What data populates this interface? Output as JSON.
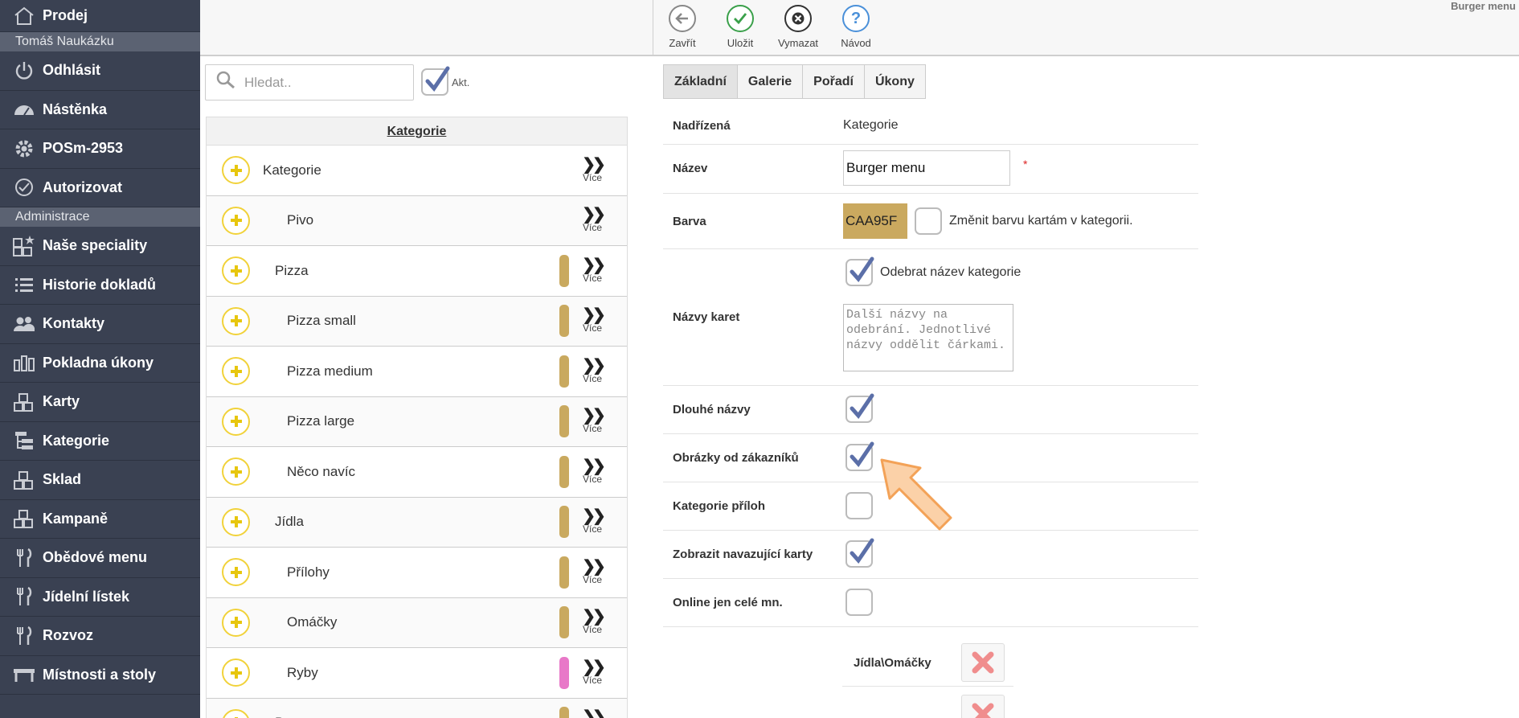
{
  "sidebar": {
    "top_item": "Prodej",
    "user_name": "Tomáš Naukázku",
    "items_a": [
      "Odhlásit",
      "Nástěnka",
      "POSm-2953",
      "Autorizovat"
    ],
    "section_admin": "Administrace",
    "items_b": [
      "Naše speciality",
      "Historie dokladů",
      "Kontakty",
      "Pokladna úkony",
      "Karty",
      "Kategorie",
      "Sklad",
      "Kampaně",
      "Obědové menu",
      "Jídelní lístek",
      "Rozvoz",
      "Místnosti a stoly"
    ]
  },
  "toolbar": {
    "close_label": "Zavřít",
    "save_label": "Uložit",
    "delete_label": "Vymazat",
    "help_label": "Návod",
    "doc_title": "Burger menu"
  },
  "search": {
    "placeholder": "Hledat..",
    "active_label": "Akt.",
    "active_checked": true
  },
  "categories": {
    "header": "Kategorie",
    "more_label": "Více",
    "rows": [
      {
        "name": "Kategorie",
        "indent": 0,
        "color": ""
      },
      {
        "name": "Pivo",
        "indent": 2,
        "color": ""
      },
      {
        "name": "Pizza",
        "indent": 1,
        "color": "#C9A95F"
      },
      {
        "name": "Pizza small",
        "indent": 2,
        "color": "#C9A95F"
      },
      {
        "name": "Pizza medium",
        "indent": 2,
        "color": "#C9A95F"
      },
      {
        "name": "Pizza large",
        "indent": 2,
        "color": "#C9A95F"
      },
      {
        "name": "Něco navíc",
        "indent": 2,
        "color": "#C9A95F"
      },
      {
        "name": "Jídla",
        "indent": 1,
        "color": "#C9A95F"
      },
      {
        "name": "Přílohy",
        "indent": 2,
        "color": "#C9A95F"
      },
      {
        "name": "Omáčky",
        "indent": 2,
        "color": "#C9A95F"
      },
      {
        "name": "Ryby",
        "indent": 2,
        "color": "#E878C8"
      },
      {
        "name": "Burger menu",
        "indent": 1,
        "color": "#C9A95F"
      }
    ]
  },
  "tabs": [
    "Základní",
    "Galerie",
    "Pořadí",
    "Úkony"
  ],
  "form": {
    "parent_label": "Nadřízená",
    "parent_value": "Kategorie",
    "name_label": "Název",
    "name_value": "Burger menu",
    "required_mark": "*",
    "color_label": "Barva",
    "color_value": "CAA95F",
    "color_hex": "#CAA95F",
    "change_color_label": "Změnit barvu kartám v kategorii.",
    "remove_name_label": "Odebrat název kategorie",
    "card_names_label": "Názvy karet",
    "card_names_placeholder": "Další názvy na odebrání. Jednotlivé názvy oddělit čárkami.",
    "long_names_label": "Dlouhé názvy",
    "customer_images_label": "Obrázky od zákazníků",
    "side_categories_label": "Kategorie příloh",
    "show_following_label": "Zobrazit navazující karty",
    "online_whole_label": "Online jen celé mn.",
    "linked_1": "Jídla\\Omáčky"
  },
  "checks": {
    "change_color": false,
    "remove_name": true,
    "long_names": true,
    "customer_images": true,
    "side_categories": false,
    "show_following": true,
    "online_whole": false
  },
  "colors": {
    "sidebar": "#3a4152",
    "accent_yellow": "#f1d23a",
    "check_blue": "#5b6fa8",
    "arrow": "#f8c08a"
  }
}
